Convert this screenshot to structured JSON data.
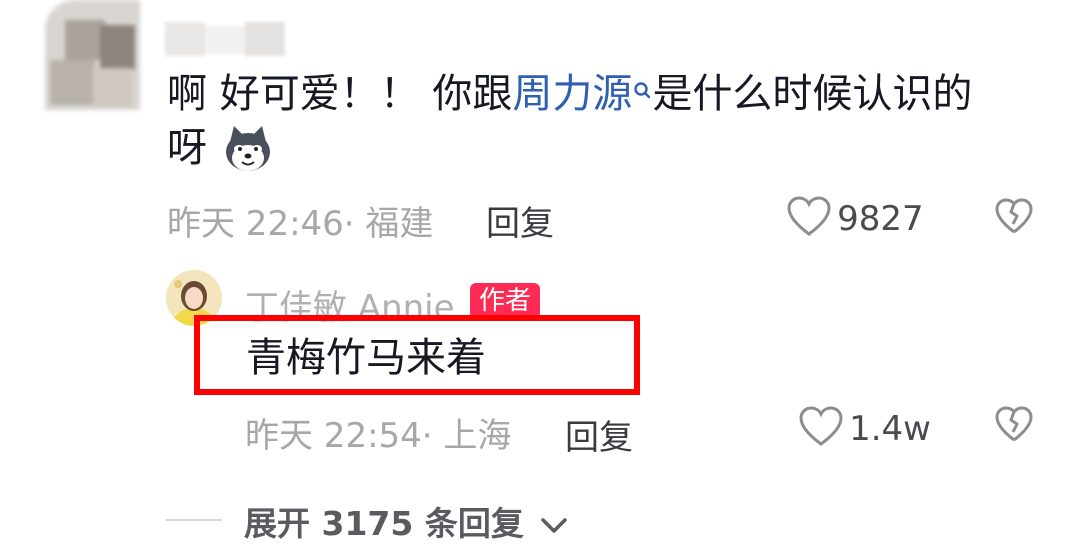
{
  "comment": {
    "line1_before": "啊 好可爱！！ 你跟",
    "mention": "周力源",
    "line1_after": "是什么时候认识的",
    "line2": "呀",
    "emoji_icon": "husky-dog-emoji",
    "time": "昨天 22:46",
    "location": "· 福建",
    "reply_label": "回复",
    "likes": "9827"
  },
  "reply": {
    "author": "丁佳敏 Annie",
    "badge": "作者",
    "text": "青梅竹马来着",
    "time": "昨天 22:54",
    "location": "· 上海",
    "reply_label": "回复",
    "likes": "1.4w"
  },
  "expand": {
    "label": "展开 3175 条回复"
  },
  "colors": {
    "mention": "#2f5fb0",
    "badge": "#fe2c55",
    "highlight": "#ff0000"
  }
}
